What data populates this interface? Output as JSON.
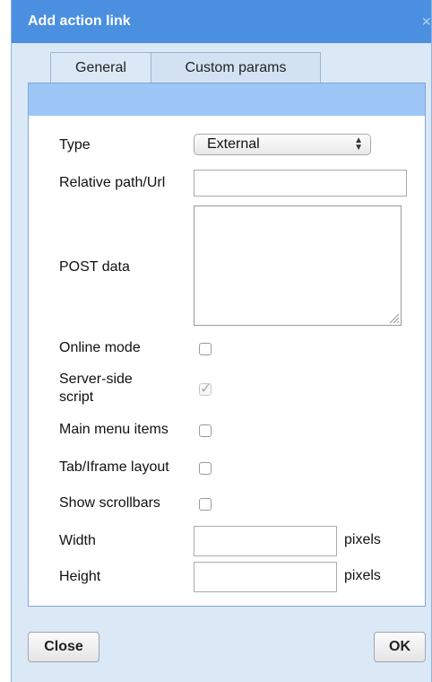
{
  "dialog": {
    "title": "Add action link",
    "close_glyph": "×"
  },
  "tabs": [
    {
      "label": "General"
    },
    {
      "label": "Custom params"
    }
  ],
  "form": {
    "type_label": "Type",
    "type_value": "External",
    "path_label": "Relative path/Url",
    "path_value": "",
    "post_label": "POST data",
    "post_value": "",
    "online_label": "Online mode",
    "online_checked": false,
    "server_label_line1": "Server-side",
    "server_label_line2": "script",
    "server_checked": true,
    "menu_label": "Main menu items",
    "menu_checked": false,
    "tab_label": "Tab/Iframe layout",
    "tab_checked": false,
    "scroll_label": "Show scrollbars",
    "scroll_checked": false,
    "width_label": "Width",
    "width_value": "",
    "height_label": "Height",
    "height_value": "",
    "unit": "pixels"
  },
  "buttons": {
    "close": "Close",
    "ok": "OK"
  },
  "colors": {
    "title_bar": "#4a8fe0",
    "panel_header": "#9dc6f7",
    "dialog_bg": "#dbe8f6"
  }
}
